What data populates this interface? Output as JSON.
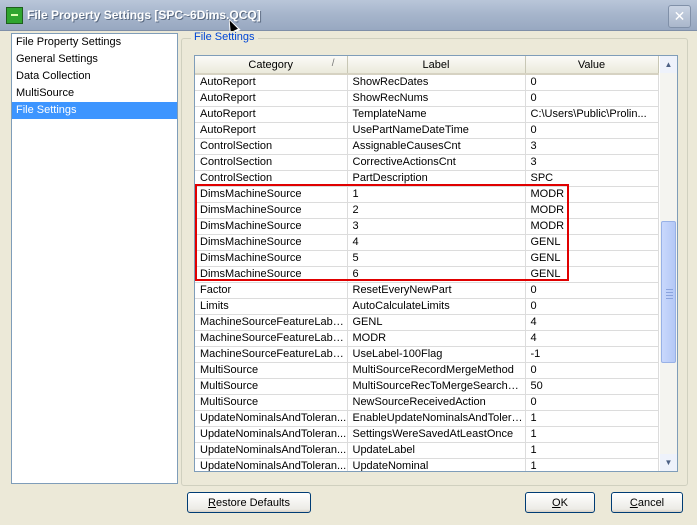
{
  "window": {
    "title": "File Property Settings [SPC~6Dims.QCQ]",
    "close_glyph": "✕"
  },
  "nav": {
    "items": [
      {
        "label": "File Property Settings",
        "selected": false
      },
      {
        "label": "General Settings",
        "selected": false
      },
      {
        "label": "Data Collection",
        "selected": false
      },
      {
        "label": "MultiSource",
        "selected": false
      },
      {
        "label": "File Settings",
        "selected": true
      }
    ],
    "selected_bg": "#3d95ff"
  },
  "group": {
    "label": "File Settings"
  },
  "grid": {
    "columns": [
      {
        "label": "Category",
        "sort_indicator": "/"
      },
      {
        "label": "Label"
      },
      {
        "label": "Value"
      }
    ],
    "rows": [
      [
        "AutoReport",
        "ShowRecDates",
        "0"
      ],
      [
        "AutoReport",
        "ShowRecNums",
        "0"
      ],
      [
        "AutoReport",
        "TemplateName",
        "C:\\Users\\Public\\Prolin..."
      ],
      [
        "AutoReport",
        "UsePartNameDateTime",
        "0"
      ],
      [
        "ControlSection",
        "AssignableCausesCnt",
        "3"
      ],
      [
        "ControlSection",
        "CorrectiveActionsCnt",
        "3"
      ],
      [
        "ControlSection",
        "PartDescription",
        "SPC"
      ],
      [
        "DimsMachineSource",
        "1",
        "MODR"
      ],
      [
        "DimsMachineSource",
        "2",
        "MODR"
      ],
      [
        "DimsMachineSource",
        "3",
        "MODR"
      ],
      [
        "DimsMachineSource",
        "4",
        "GENL"
      ],
      [
        "DimsMachineSource",
        "5",
        "GENL"
      ],
      [
        "DimsMachineSource",
        "6",
        "GENL"
      ],
      [
        "Factor",
        "ResetEveryNewPart",
        "0"
      ],
      [
        "Limits",
        "AutoCalculateLimits",
        "0"
      ],
      [
        "MachineSourceFeatureLabe...",
        "GENL",
        "4"
      ],
      [
        "MachineSourceFeatureLabe...",
        "MODR",
        "4"
      ],
      [
        "MachineSourceFeatureLabe...",
        "UseLabel-100Flag",
        "-1"
      ],
      [
        "MultiSource",
        "MultiSourceRecordMergeMethod",
        "0"
      ],
      [
        "MultiSource",
        "MultiSourceRecToMergeSearchLi...",
        "50"
      ],
      [
        "MultiSource",
        "NewSourceReceivedAction",
        "0"
      ],
      [
        "UpdateNominalsAndToleran...",
        "EnableUpdateNominalsAndTolera...",
        "1"
      ],
      [
        "UpdateNominalsAndToleran...",
        "SettingsWereSavedAtLeastOnce",
        "1"
      ],
      [
        "UpdateNominalsAndToleran...",
        "UpdateLabel",
        "1"
      ],
      [
        "UpdateNominalsAndToleran...",
        "UpdateNominal",
        "1"
      ]
    ],
    "highlight_color": "#e00000",
    "scroll": {
      "up_glyph": "▲",
      "down_glyph": "▼",
      "position": 0.62
    }
  },
  "buttons": {
    "restore": {
      "accel": "R",
      "rest": "estore Defaults"
    },
    "ok": {
      "accel": "O",
      "rest": "K"
    },
    "cancel": {
      "accel": "C",
      "rest": "ancel"
    }
  }
}
